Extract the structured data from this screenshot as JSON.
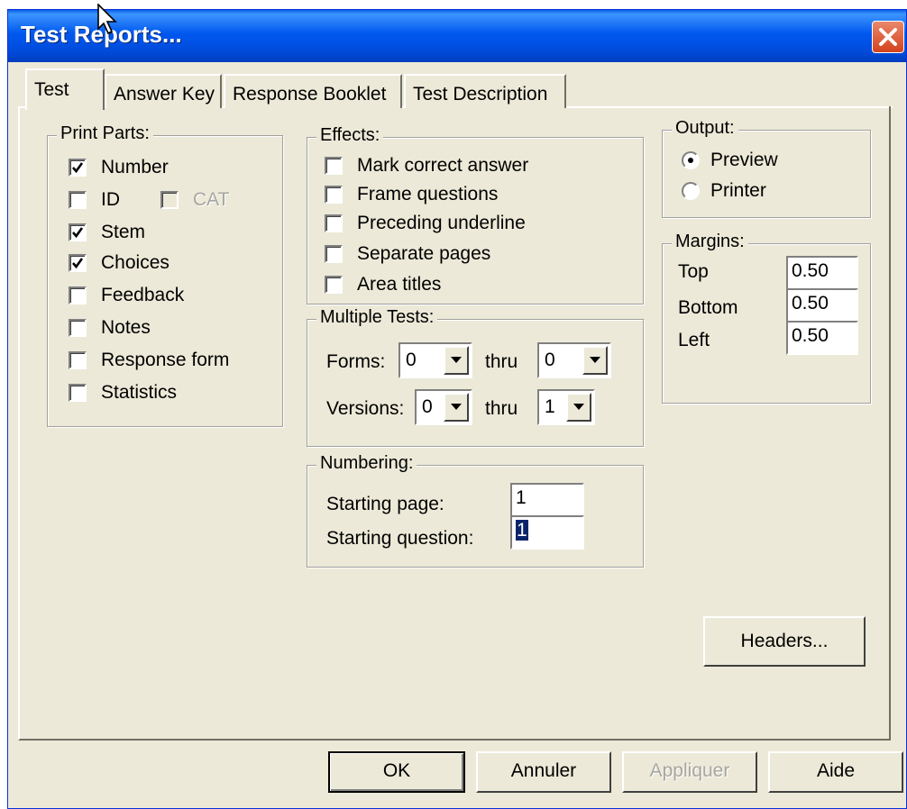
{
  "window": {
    "title": "Test Reports..."
  },
  "tabs": [
    {
      "label": "Test",
      "active": true
    },
    {
      "label": "Answer Key",
      "active": false
    },
    {
      "label": "Response Booklet",
      "active": false
    },
    {
      "label": "Test Description",
      "active": false
    }
  ],
  "print_parts": {
    "label": "Print Parts:",
    "items": [
      {
        "label": "Number",
        "checked": true
      },
      {
        "label": "ID",
        "checked": false
      },
      {
        "label": "Stem",
        "checked": true
      },
      {
        "label": "Choices",
        "checked": true
      },
      {
        "label": "Feedback",
        "checked": false
      },
      {
        "label": "Notes",
        "checked": false
      },
      {
        "label": "Response form",
        "checked": false
      },
      {
        "label": "Statistics",
        "checked": false
      }
    ],
    "cat": {
      "label": "CAT",
      "checked": false,
      "disabled": true
    }
  },
  "effects": {
    "label": "Effects:",
    "items": [
      {
        "label": "Mark correct answer",
        "checked": false
      },
      {
        "label": "Frame questions",
        "checked": false
      },
      {
        "label": "Preceding underline",
        "checked": false
      },
      {
        "label": "Separate pages",
        "checked": false
      },
      {
        "label": "Area titles",
        "checked": false
      }
    ]
  },
  "multiple_tests": {
    "label": "Multiple Tests:",
    "forms_label": "Forms:",
    "forms_from": "0",
    "forms_thru_label": "thru",
    "forms_to": "0",
    "versions_label": "Versions:",
    "versions_from": "0",
    "versions_thru_label": "thru",
    "versions_to": "1"
  },
  "numbering": {
    "label": "Numbering:",
    "starting_page_label": "Starting page:",
    "starting_page": "1",
    "starting_question_label": "Starting question:",
    "starting_question": "1"
  },
  "output": {
    "label": "Output:",
    "options": [
      {
        "label": "Preview",
        "selected": true
      },
      {
        "label": "Printer",
        "selected": false
      }
    ]
  },
  "margins": {
    "label": "Margins:",
    "top_label": "Top",
    "top": "0.50",
    "bottom_label": "Bottom",
    "bottom": "0.50",
    "left_label": "Left",
    "left": "0.50"
  },
  "buttons": {
    "headers": "Headers...",
    "ok": "OK",
    "cancel": "Annuler",
    "apply": "Appliquer",
    "help": "Aide"
  }
}
